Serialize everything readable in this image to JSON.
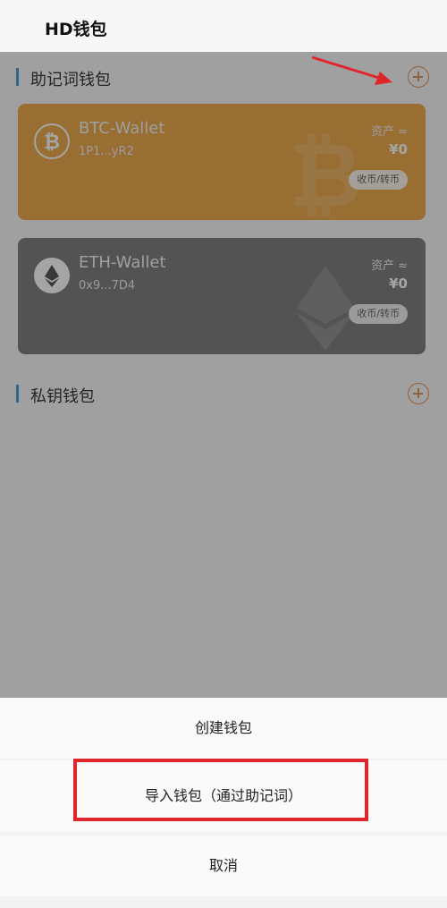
{
  "header": {
    "title": "HD钱包"
  },
  "sections": {
    "mnemonic": {
      "title": "助记词钱包"
    },
    "private_key": {
      "title": "私钥钱包"
    }
  },
  "wallets": [
    {
      "name": "BTC-Wallet",
      "address": "1P1...yR2",
      "asset_label": "资产 ≈",
      "asset_value": "¥0",
      "action": "收币/转币",
      "icon": "bitcoin-icon",
      "color": "#e8a13a"
    },
    {
      "name": "ETH-Wallet",
      "address": "0x9...7D4",
      "asset_label": "资产 ≈",
      "asset_value": "¥0",
      "action": "收币/转币",
      "icon": "ethereum-icon",
      "color": "#737373"
    }
  ],
  "sheet": {
    "create": "创建钱包",
    "import": "导入钱包（通过助记词）",
    "cancel": "取消"
  },
  "colors": {
    "accent": "#e0884a",
    "highlight": "#e0262b",
    "section_bar": "#3b8fd1"
  }
}
